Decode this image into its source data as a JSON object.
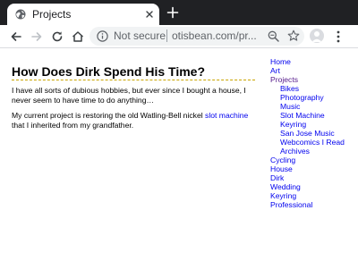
{
  "browser": {
    "tab_title": "Projects",
    "omnibox_security": "Not secure",
    "omnibox_url": "otisbean.com/pr..."
  },
  "page": {
    "title": "How Does Dirk Spend His Time?",
    "paragraph1": "I have all sorts of dubious hobbies, but ever since I bought a house, I never seem to have time to do anything…",
    "paragraph2_before": "My current project is restoring the old Watling-Bell nickel ",
    "paragraph2_link": "slot machine",
    "paragraph2_after": " that I inherited from my grandfather."
  },
  "nav": {
    "home": "Home",
    "art": "Art",
    "projects": "Projects",
    "sub": [
      "Bikes",
      "Photography",
      "Music",
      "Slot Machine",
      "Keyring",
      "San Jose Music",
      "Webcomics I Read",
      "Archives"
    ],
    "cycling": "Cycling",
    "house": "House",
    "dirk": "Dirk",
    "wedding": "Wedding",
    "keyring": "Keyring",
    "professional": "Professional"
  },
  "colors": {
    "link": "#0000ee",
    "visited_link": "#551a8b",
    "title_underline": "#c9a400",
    "tabstrip": "#202124"
  }
}
